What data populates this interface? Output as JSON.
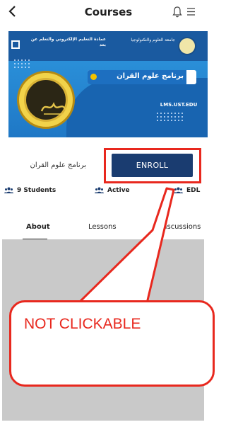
{
  "header": {
    "title": "Courses",
    "back_icon": "chevron-left-icon",
    "notification_icon": "bell-icon",
    "menu_icon": "menu-icon"
  },
  "banner": {
    "university_name": "جامعة العلوم والتكنولوجيا",
    "center_name": "عمادة التعليم الإلكتروني والتعلم عن بعد",
    "program_label": "برنامج علوم القران",
    "emblem_text": "القرآن الكريم",
    "site": "LMS.UST.EDU"
  },
  "course": {
    "name": "برنامج علوم القران",
    "enroll_label": "ENROLL"
  },
  "stats": {
    "students": "9 Students",
    "status": "Active",
    "type": "EDL"
  },
  "tabs": [
    {
      "label": "About"
    },
    {
      "label": "Lessons"
    },
    {
      "label": "Discussions"
    }
  ],
  "annotation": {
    "text": "NOT CLICKABLE"
  },
  "colors": {
    "annotation": "#e8281e",
    "enroll_button": "#1a3c70",
    "banner_blue": "#1e86d2",
    "content_bg": "#c9c9c9"
  }
}
